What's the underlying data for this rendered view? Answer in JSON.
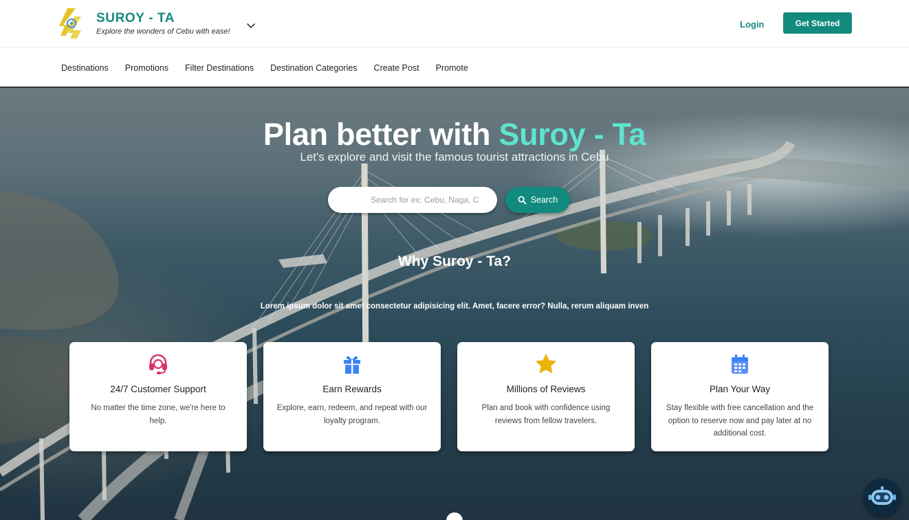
{
  "header": {
    "brand_title": "SUROY - TA",
    "brand_tagline": "Explore the wonders of Cebu with ease!",
    "login_label": "Login",
    "get_started_label": "Get Started"
  },
  "nav": {
    "items": [
      {
        "label": "Destinations"
      },
      {
        "label": "Promotions"
      },
      {
        "label": "Filter Destinations"
      },
      {
        "label": "Destination Categories"
      },
      {
        "label": "Create Post"
      },
      {
        "label": "Promote"
      }
    ]
  },
  "hero": {
    "title_main": "Plan better with ",
    "title_accent": "Suroy - Ta",
    "subtitle": "Let's explore and visit the famous tourist attractions in Cebu",
    "search_placeholder": "Search for ex: Cebu, Naga, Carcar",
    "search_button": "Search",
    "why_title": "Why Suroy - Ta?",
    "why_text": "Lorem ipsum dolor sit amet consectetur adipisicing elit. Amet, facere error? Nulla, rerum aliquam inven"
  },
  "features": [
    {
      "icon": "headset-icon",
      "color": "#d6336c",
      "title": "24/7 Customer Support",
      "desc": "No matter the time zone, we're here to help."
    },
    {
      "icon": "gift-icon",
      "color": "#3b82f6",
      "title": "Earn Rewards",
      "desc": "Explore, earn, redeem, and repeat with our loyalty program."
    },
    {
      "icon": "star-icon",
      "color": "#eab308",
      "title": "Millions of Reviews",
      "desc": "Plan and book with confidence using reviews from fellow travelers."
    },
    {
      "icon": "calendar-icon",
      "color": "#3b82f6",
      "title": "Plan Your Way",
      "desc": "Stay flexible with free cancellation and the option to reserve now and pay later at no additional cost."
    }
  ],
  "colors": {
    "brand": "#128a7e",
    "accent_title": "#5fe3cf",
    "chat_bubble": "#0e2a3e"
  }
}
